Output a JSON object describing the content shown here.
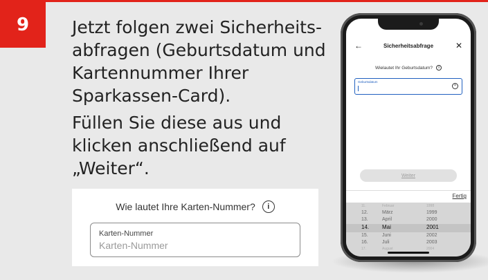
{
  "step": {
    "number": "9"
  },
  "instructions": {
    "paragraph1": [
      "Jetzt folgen zwei Sicherheits-",
      "abfragen (Geburtsdatum und",
      "Kartennummer Ihrer",
      "Sparkassen-Card)."
    ],
    "paragraph2": [
      "Füllen Sie diese aus und",
      "klicken anschließend auf",
      "„Weiter“."
    ]
  },
  "inset": {
    "question": "Wie lautet Ihre Karten-Nummer?",
    "info_icon": "info-icon",
    "field_label": "Karten-Nummer",
    "field_placeholder": "Karten-Nummer"
  },
  "phone": {
    "nav_back": "←",
    "nav_title": "Sicherheitsabfrage",
    "nav_close": "✕",
    "question": "Wielautet Ihr Geburtsdatum?",
    "field_label": "Geburtsdatum",
    "clear_icon": "clear-icon",
    "weiter": "Weiter",
    "fertig": "Fertig",
    "picker": [
      {
        "day": "11.",
        "month": "Februar",
        "year": "1998",
        "state": "faint"
      },
      {
        "day": "12.",
        "month": "März",
        "year": "1999",
        "state": ""
      },
      {
        "day": "13.",
        "month": "April",
        "year": "2000",
        "state": ""
      },
      {
        "day": "14.",
        "month": "Mai",
        "year": "2001",
        "state": "selected"
      },
      {
        "day": "15.",
        "month": "Juni",
        "year": "2002",
        "state": ""
      },
      {
        "day": "16.",
        "month": "Juli",
        "year": "2003",
        "state": ""
      },
      {
        "day": "17.",
        "month": "August",
        "year": "2004",
        "state": "faint"
      }
    ]
  },
  "colors": {
    "accent": "#e2231a",
    "panel": "#e9e9e9",
    "field_focus": "#1f5fbf"
  }
}
